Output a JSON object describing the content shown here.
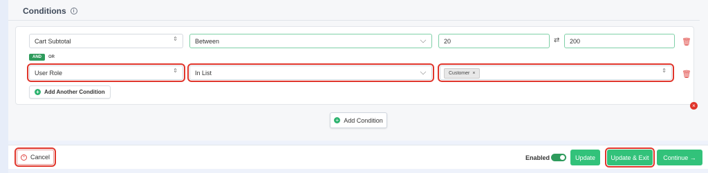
{
  "panel": {
    "title": "Conditions"
  },
  "condition_rows": [
    {
      "field": "Cart Subtotal",
      "operator": "Between",
      "value_from": "20",
      "value_to": "200"
    },
    {
      "field": "User Role",
      "operator": "In List",
      "tag": "Customer",
      "tag_remove": "×"
    }
  ],
  "logic": {
    "and_label": "AND",
    "or_label": "OR"
  },
  "buttons": {
    "add_another_condition": "Add Another Condition",
    "add_condition": "Add Condition",
    "cancel": "Cancel",
    "update": "Update",
    "update_exit": "Update & Exit",
    "continue": "Continue →"
  },
  "footer": {
    "enabled_label": "Enabled"
  },
  "icons": {
    "swap": "⇄",
    "trash": "🗑",
    "info": "i",
    "close": "×",
    "plus": "+",
    "updown": "⇕"
  },
  "colors": {
    "accent_green": "#32c27a",
    "dark_green": "#2e9b5c",
    "highlight_red": "#e0352b"
  }
}
